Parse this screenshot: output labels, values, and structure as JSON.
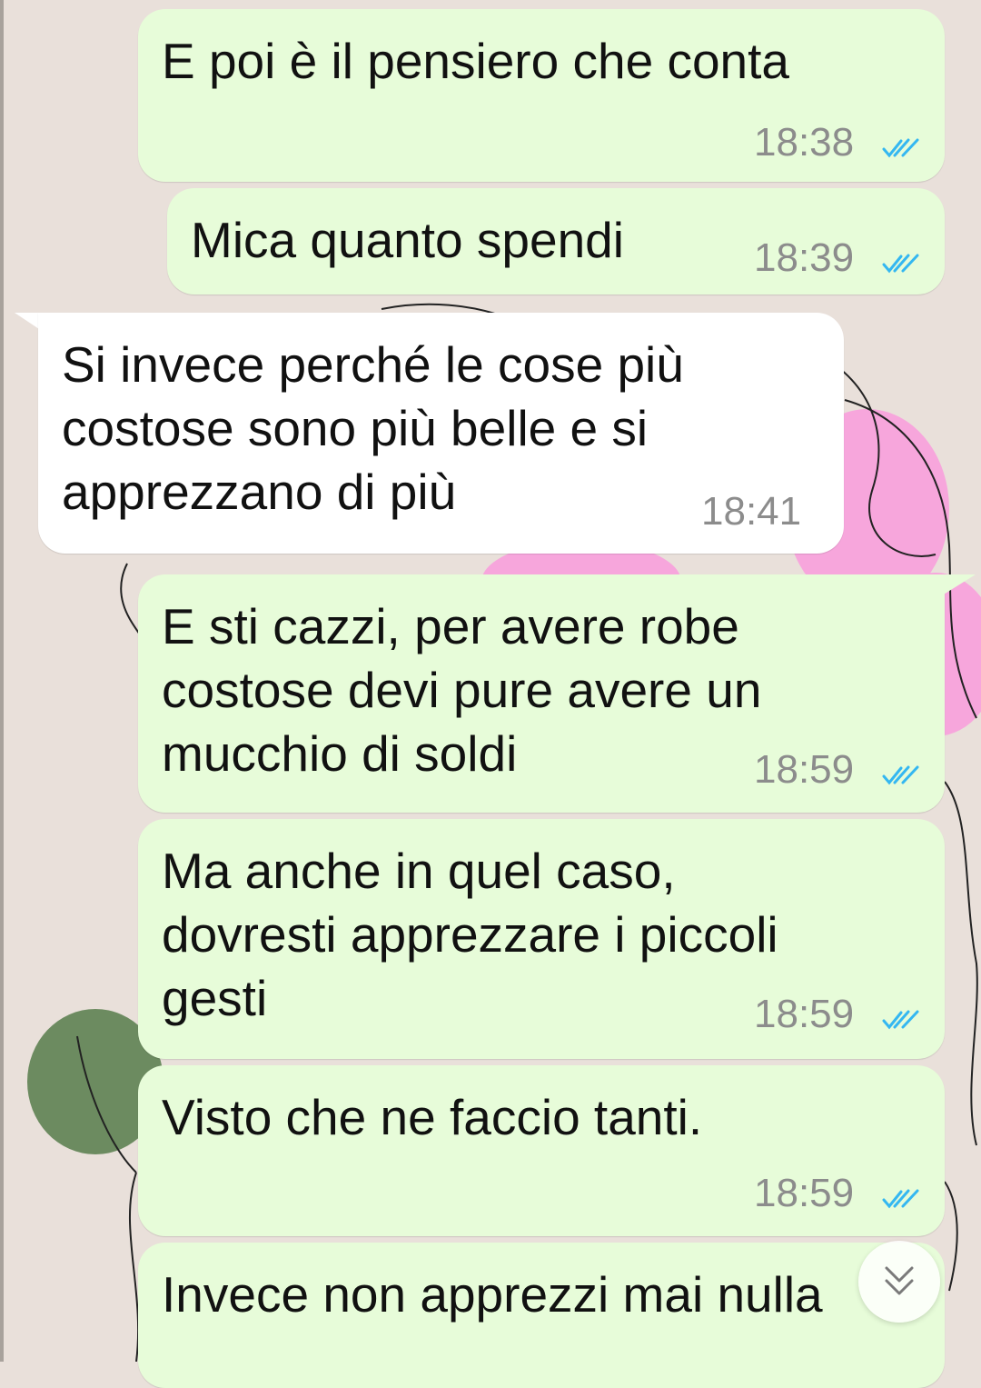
{
  "theme": {
    "outgoing_bubble": "#e7fcd9",
    "incoming_bubble": "#ffffff",
    "read_tick_color": "#34b7f1",
    "wallpaper_background": "#e9e0da"
  },
  "messages": [
    {
      "direction": "outgoing",
      "text_lines": [
        "E poi è il pensiero che conta"
      ],
      "time": "18:38",
      "status": "read"
    },
    {
      "direction": "outgoing",
      "text_lines": [
        "Mica quanto spendi"
      ],
      "time": "18:39",
      "status": "read"
    },
    {
      "direction": "incoming",
      "text_lines": [
        "Si invece perché le cose più",
        "costose sono più belle e si",
        "apprezzano di più"
      ],
      "time": "18:41"
    },
    {
      "direction": "outgoing",
      "text_lines": [
        "E sti cazzi, per avere robe",
        "costose devi pure avere un",
        "mucchio di soldi"
      ],
      "time": "18:59",
      "status": "read"
    },
    {
      "direction": "outgoing",
      "text_lines": [
        "Ma anche in quel caso,",
        "dovresti apprezzare i piccoli",
        "gesti"
      ],
      "time": "18:59",
      "status": "read"
    },
    {
      "direction": "outgoing",
      "text_lines": [
        "Visto che ne faccio tanti."
      ],
      "time": "18:59",
      "status": "read"
    },
    {
      "direction": "outgoing",
      "text_lines": [
        "Invece non apprezzi mai nulla"
      ],
      "time": "",
      "status": "read"
    }
  ],
  "scroll_button": {
    "icon": "double-chevron-down-icon"
  }
}
